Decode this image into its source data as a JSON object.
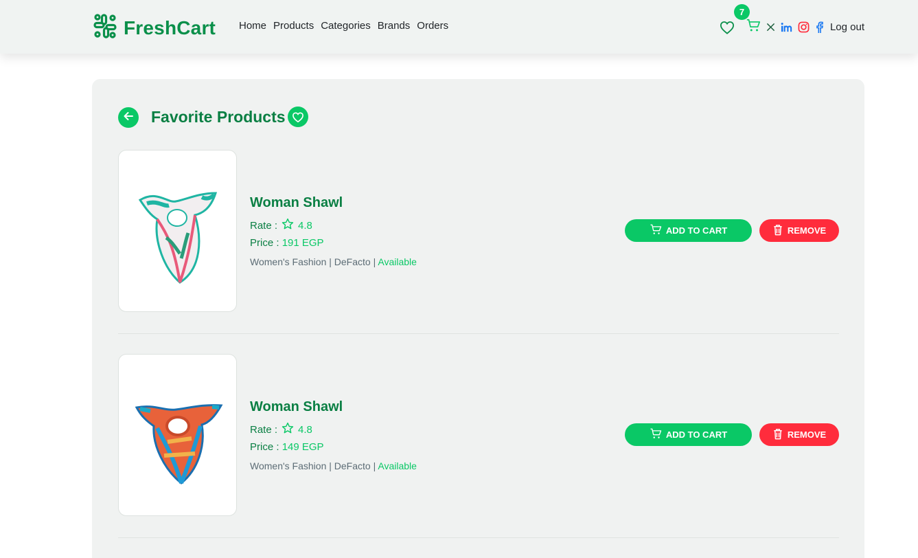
{
  "brand": {
    "name": "FreshCart",
    "logo_icon": "brand-logo-icon"
  },
  "nav": {
    "links": [
      "Home",
      "Products",
      "Categories",
      "Brands",
      "Orders"
    ],
    "cart_count": "7",
    "logout_label": "Log out",
    "icons": [
      "heart-icon",
      "cart-icon",
      "x-twitter-icon",
      "linkedin-icon",
      "instagram-icon",
      "facebook-icon"
    ]
  },
  "page": {
    "title": "Favorite Products"
  },
  "items": [
    {
      "name": "Woman Shawl",
      "rate_label": "Rate :",
      "rating": "4.8",
      "price_label": "Price :",
      "price": "191 EGP",
      "category": "Women's Fashion",
      "brand": "DeFacto",
      "status": "Available",
      "add_label": "ADD TO CART",
      "remove_label": "REMOVE"
    },
    {
      "name": "Woman Shawl",
      "rate_label": "Rate :",
      "rating": "4.8",
      "price_label": "Price :",
      "price": "149 EGP",
      "category": "Women's Fashion",
      "brand": "DeFacto",
      "status": "Available",
      "add_label": "ADD TO CART",
      "remove_label": "REMOVE"
    }
  ],
  "colors": {
    "accent": "#0ac866",
    "title_green": "#0a7f43",
    "danger": "#ff2c3c",
    "panel": "#f0f2f1"
  }
}
